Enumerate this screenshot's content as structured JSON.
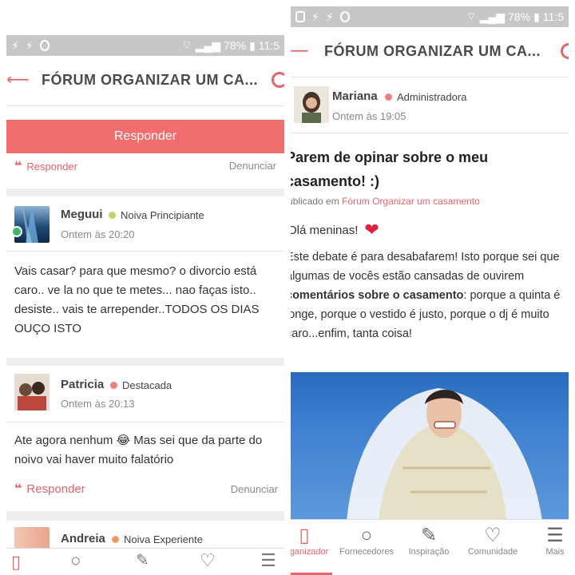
{
  "status_bar": {
    "left": {
      "battery": "78%",
      "time": "11:5"
    },
    "right": {
      "battery": "78%",
      "time": "11:5"
    }
  },
  "left_screen": {
    "title": "FÓRUM ORGANIZAR UM CA...",
    "respond_button": "Responder",
    "prev_reply_label": "Responder",
    "prev_report_label": "Denunciar",
    "comments": [
      {
        "name": "Meguui",
        "rank": "Noiva Principiante",
        "rank_color": "#b9d86a",
        "time": "Ontem às 20:20",
        "text": "Vais casar? para que mesmo? o divorcio está caro.. ve la no que te metes... nao faças isto.. desiste.. vais te arrepender..TODOS OS DIAS OUÇO ISTO"
      },
      {
        "name": "Patricia",
        "rank": "Destacada",
        "rank_color": "#ef7f7a",
        "time": "Ontem às 20:13",
        "text": "Ate agora nenhum 😂 Mas sei que da parte do noivo vai haver muito falatório",
        "reply_label": "Responder",
        "report_label": "Denunciar"
      },
      {
        "name": "Andreia",
        "rank": "Noiva Experiente",
        "rank_color": "#f39a64"
      }
    ]
  },
  "right_screen": {
    "title": "FÓRUM ORGANIZAR UM CA...",
    "author": {
      "name": "Mariana",
      "rank": "Administradora",
      "rank_color": "#ef7f7a",
      "time": "Ontem às 19:05"
    },
    "post_title_line1": "Parem de opinar sobre o meu",
    "post_title_line2": "casamento! :)",
    "published_prefix": "ublicado em",
    "forum_name": "Fórum Organizar um casamento",
    "hello": "Olá meninas!",
    "body_lines": [
      "Este debate é para desabafarem! Isto porque sei que",
      "algumas de vocês estão cansadas de ouvirem",
      "comentários sobre o casamento: porque a quinta é",
      "longe, porque o vestido é justo, porque o dj é muito",
      "caro...enfim, tanta coisa!"
    ],
    "body_bold_part": "comentários sobre o casamento",
    "nav": [
      {
        "label": "Organizador",
        "icon": "notebook-icon",
        "active": true
      },
      {
        "label": "Fornecedores",
        "icon": "search-icon",
        "active": false
      },
      {
        "label": "Inspiração",
        "icon": "inspiration-icon",
        "active": false
      },
      {
        "label": "Comunidade",
        "icon": "community-heart-icon",
        "active": false
      },
      {
        "label": "Mais",
        "icon": "menu-icon",
        "active": false
      }
    ]
  },
  "colors": {
    "accent": "#e8646b",
    "button": "#f26e6e",
    "status_bar": "#c7c7c7"
  }
}
